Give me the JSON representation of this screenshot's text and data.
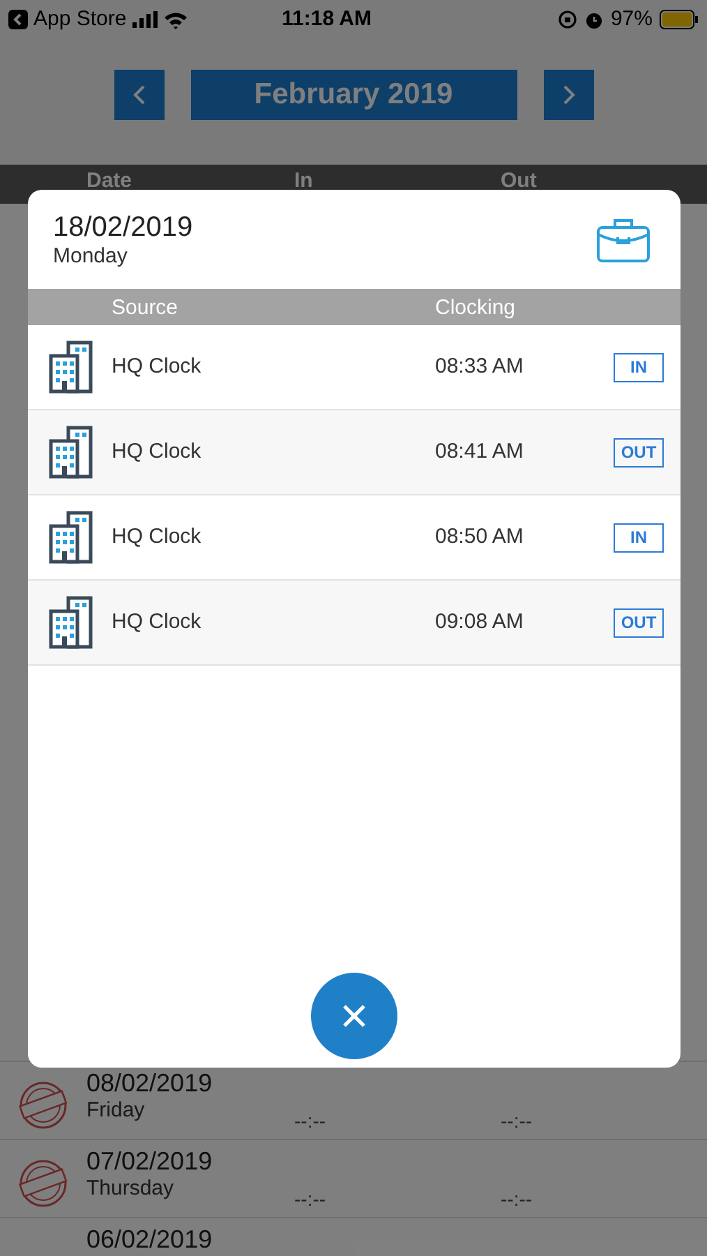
{
  "status_bar": {
    "back_app": "App Store",
    "time": "11:18 AM",
    "battery": "97%"
  },
  "month_nav": {
    "title": "February 2019"
  },
  "list_header": {
    "columns": [
      "Date",
      "In",
      "Out"
    ]
  },
  "days": [
    {
      "date": "08/02/2019",
      "weekday": "Friday",
      "kind": "absent",
      "in": "--:--",
      "out": "--:--"
    },
    {
      "date": "07/02/2019",
      "weekday": "Thursday",
      "kind": "absent",
      "in": "--:--",
      "out": "--:--"
    },
    {
      "date": "06/02/2019"
    }
  ],
  "dialog": {
    "date": "18/02/2019",
    "weekday": "Monday",
    "columns": [
      "Source",
      "Clocking"
    ],
    "clockings": [
      {
        "source": "HQ Clock",
        "time": "08:33 AM",
        "direction": "IN"
      },
      {
        "source": "HQ Clock",
        "time": "08:41 AM",
        "direction": "OUT"
      },
      {
        "source": "HQ Clock",
        "time": "08:50 AM",
        "direction": "IN"
      },
      {
        "source": "HQ Clock",
        "time": "09:08 AM",
        "direction": "OUT"
      }
    ]
  }
}
